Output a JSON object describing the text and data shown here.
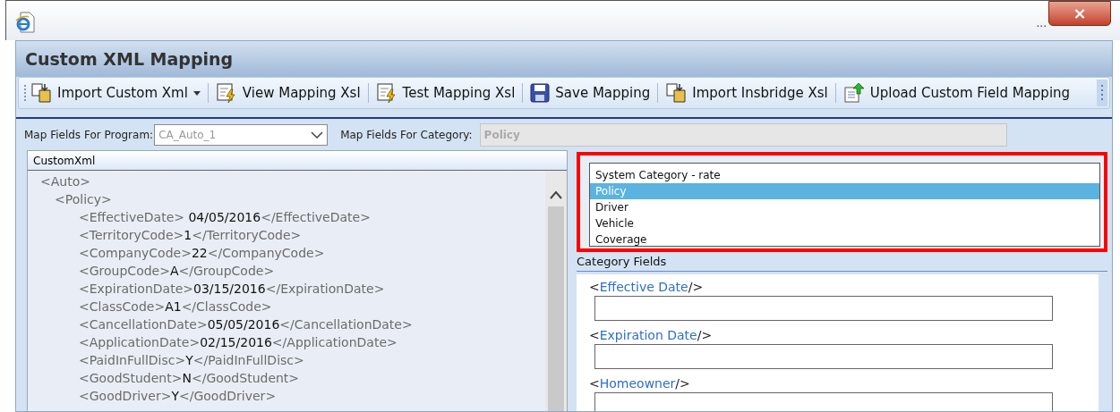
{
  "window": {
    "title_ellipsis": "...",
    "close": "×"
  },
  "panel": {
    "title": "Custom XML Mapping"
  },
  "toolbar": [
    {
      "label": "Import Custom Xml",
      "kind": "import",
      "dropdown": true
    },
    {
      "label": "View Mapping Xsl",
      "kind": "xsl",
      "dropdown": false
    },
    {
      "label": "Test Mapping Xsl",
      "kind": "xsl",
      "dropdown": false
    },
    {
      "label": "Save Mapping",
      "kind": "save",
      "dropdown": false
    },
    {
      "label": "Import Insbridge Xsl",
      "kind": "import",
      "dropdown": false
    },
    {
      "label": "Upload Custom Field Mapping",
      "kind": "upload",
      "dropdown": false
    }
  ],
  "filters": {
    "program_label": "Map Fields For Program:",
    "program_value": "CA_Auto_1",
    "category_label": "Map Fields For Category:",
    "category_value": "Policy"
  },
  "custom_xml": {
    "header": "CustomXml",
    "tree": [
      {
        "parts": [
          {
            "kind": "tag",
            "text": "<Auto>"
          }
        ],
        "children": [
          {
            "parts": [
              {
                "kind": "tag",
                "text": "<Policy>"
              }
            ],
            "children": [
              {
                "parts": [
                  {
                    "kind": "tag",
                    "text": "<EffectiveDate>"
                  },
                  {
                    "kind": "value",
                    "text": " 04/05/2016"
                  },
                  {
                    "kind": "tag",
                    "text": "</EffectiveDate>"
                  }
                ]
              },
              {
                "parts": [
                  {
                    "kind": "tag",
                    "text": "<TerritoryCode>"
                  },
                  {
                    "kind": "value",
                    "text": "1"
                  },
                  {
                    "kind": "tag",
                    "text": "</TerritoryCode>"
                  }
                ]
              },
              {
                "parts": [
                  {
                    "kind": "tag",
                    "text": "<CompanyCode>"
                  },
                  {
                    "kind": "value",
                    "text": "22"
                  },
                  {
                    "kind": "tag",
                    "text": "</CompanyCode>"
                  }
                ]
              },
              {
                "parts": [
                  {
                    "kind": "tag",
                    "text": "<GroupCode>"
                  },
                  {
                    "kind": "value",
                    "text": "A"
                  },
                  {
                    "kind": "tag",
                    "text": "</GroupCode>"
                  }
                ]
              },
              {
                "parts": [
                  {
                    "kind": "tag",
                    "text": "<ExpirationDate>"
                  },
                  {
                    "kind": "value",
                    "text": "03/15/2016"
                  },
                  {
                    "kind": "tag",
                    "text": "</ExpirationDate>"
                  }
                ]
              },
              {
                "parts": [
                  {
                    "kind": "tag",
                    "text": "<ClassCode>"
                  },
                  {
                    "kind": "value",
                    "text": "A1"
                  },
                  {
                    "kind": "tag",
                    "text": "</ClassCode>"
                  }
                ]
              },
              {
                "parts": [
                  {
                    "kind": "tag",
                    "text": "<CancellationDate>"
                  },
                  {
                    "kind": "value",
                    "text": "05/05/2016"
                  },
                  {
                    "kind": "tag",
                    "text": "</CancellationDate>"
                  }
                ]
              },
              {
                "parts": [
                  {
                    "kind": "tag",
                    "text": "<ApplicationDate>"
                  },
                  {
                    "kind": "value",
                    "text": "02/15/2016"
                  },
                  {
                    "kind": "tag",
                    "text": "</ApplicationDate>"
                  }
                ]
              },
              {
                "parts": [
                  {
                    "kind": "tag",
                    "text": "<PaidInFullDisc>"
                  },
                  {
                    "kind": "value",
                    "text": "Y"
                  },
                  {
                    "kind": "tag",
                    "text": "</PaidInFullDisc>"
                  }
                ]
              },
              {
                "parts": [
                  {
                    "kind": "tag",
                    "text": "<GoodStudent>"
                  },
                  {
                    "kind": "value",
                    "text": "N"
                  },
                  {
                    "kind": "tag",
                    "text": "</GoodStudent>"
                  }
                ]
              },
              {
                "parts": [
                  {
                    "kind": "tag",
                    "text": "<GoodDriver>"
                  },
                  {
                    "kind": "value",
                    "text": "Y"
                  },
                  {
                    "kind": "tag",
                    "text": "</GoodDriver>"
                  }
                ]
              }
            ]
          }
        ]
      }
    ]
  },
  "categories": {
    "items": [
      {
        "label": "System Category - rate",
        "selected": false
      },
      {
        "label": "Policy",
        "selected": true
      },
      {
        "label": "Driver",
        "selected": false
      },
      {
        "label": "Vehicle",
        "selected": false
      },
      {
        "label": "Coverage",
        "selected": false
      }
    ]
  },
  "category_fields": {
    "header": "Category Fields",
    "fields": [
      {
        "parts": [
          {
            "kind": "bracket",
            "text": "<"
          },
          {
            "kind": "name",
            "text": "Effective Date"
          },
          {
            "kind": "bracket",
            "text": "/>"
          }
        ]
      },
      {
        "parts": [
          {
            "kind": "bracket",
            "text": "<"
          },
          {
            "kind": "name",
            "text": "Expiration Date"
          },
          {
            "kind": "bracket",
            "text": "/>"
          }
        ]
      },
      {
        "parts": [
          {
            "kind": "bracket",
            "text": "<"
          },
          {
            "kind": "name",
            "text": "Homeowner"
          },
          {
            "kind": "bracket",
            "text": "/>"
          }
        ]
      }
    ]
  }
}
